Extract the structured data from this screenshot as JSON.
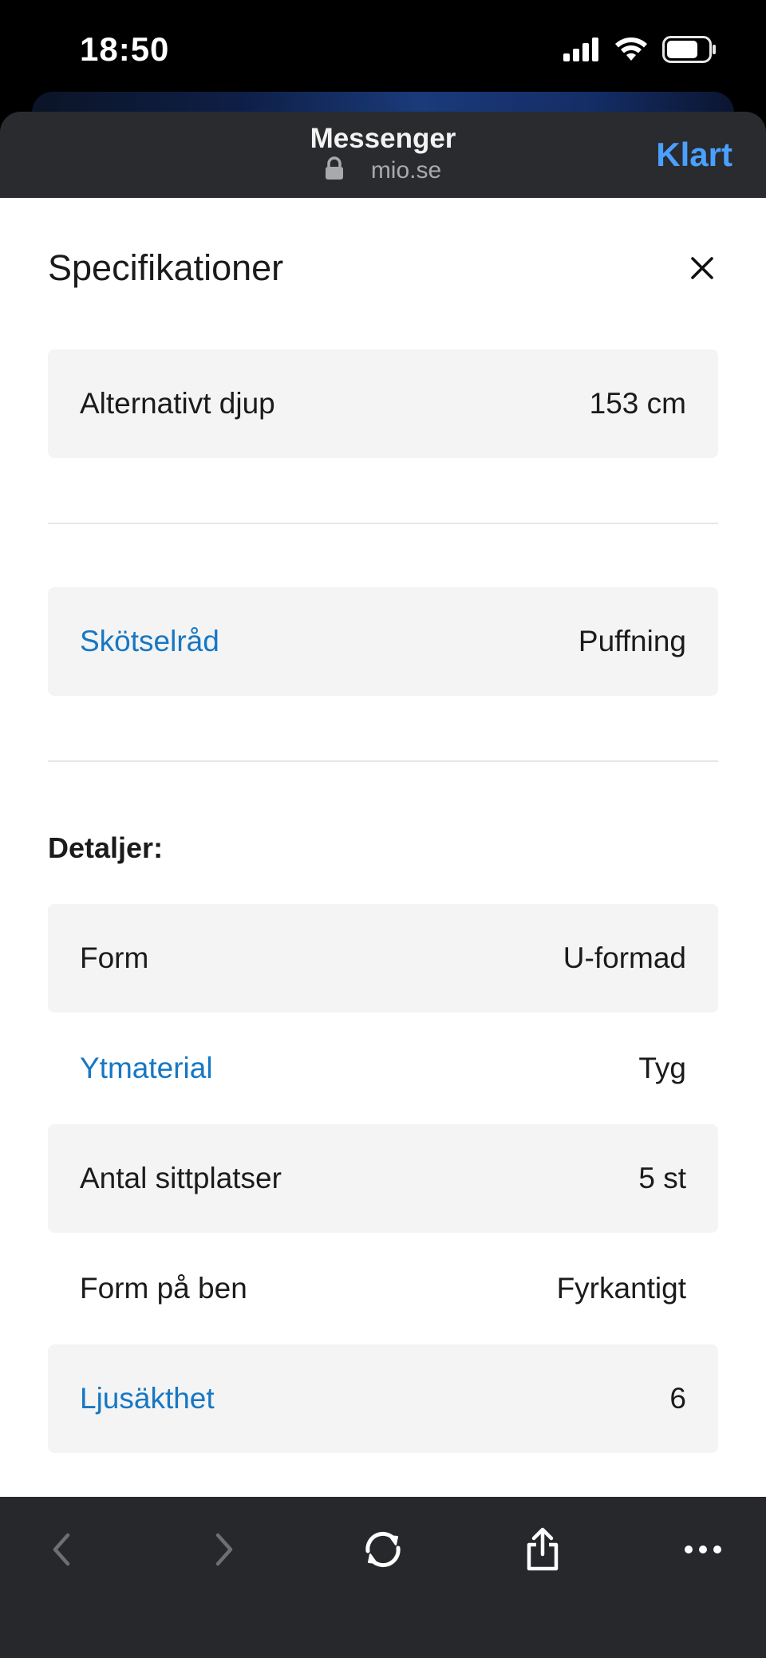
{
  "status_bar": {
    "time": "18:50"
  },
  "browser": {
    "title": "Messenger",
    "url": "mio.se",
    "done_label": "Klart"
  },
  "sheet": {
    "title": "Specifikationer",
    "top_rows": [
      {
        "label": "Alternativt djup",
        "value": "153 cm",
        "link": false
      },
      {
        "label": "Skötselråd",
        "value": "Puffning",
        "link": true
      }
    ],
    "details_heading": "Detaljer:",
    "details_rows": [
      {
        "label": "Form",
        "value": "U-formad",
        "link": false
      },
      {
        "label": "Ytmaterial",
        "value": "Tyg",
        "link": true
      },
      {
        "label": "Antal sittplatser",
        "value": "5 st",
        "link": false
      },
      {
        "label": "Form på ben",
        "value": "Fyrkantigt",
        "link": false
      },
      {
        "label": "Ljusäkthet",
        "value": "6",
        "link": true
      }
    ]
  },
  "colors": {
    "link": "#1677c4",
    "accent": "#4aa0ff",
    "toolbar_bg": "#27282b",
    "header_bg": "#2a2b2e"
  },
  "toolbar": {
    "icons": [
      "back-icon",
      "forward-icon",
      "reload-icon",
      "share-icon",
      "more-icon"
    ]
  }
}
